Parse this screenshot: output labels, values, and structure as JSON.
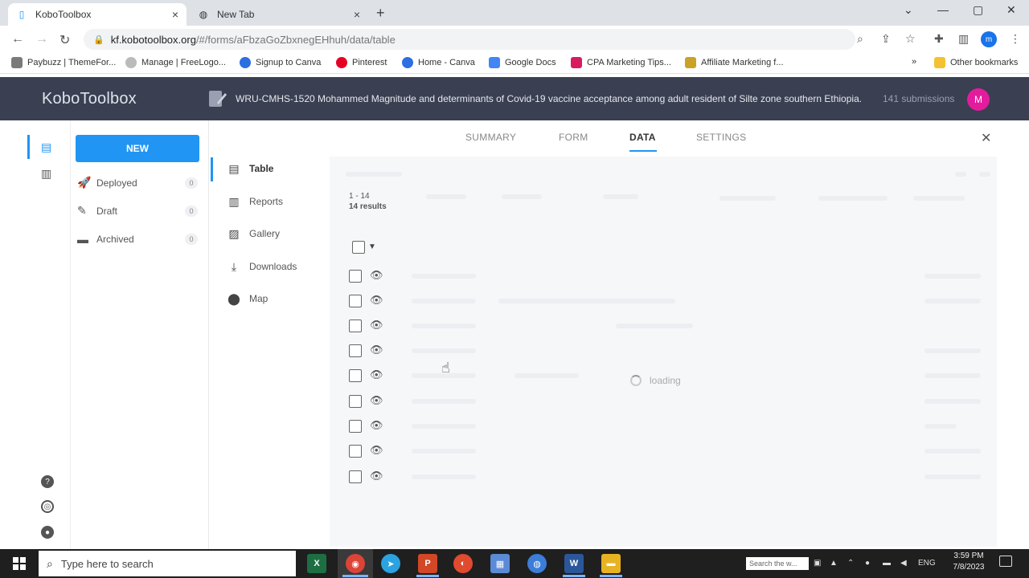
{
  "browser": {
    "tabs": [
      {
        "title": "KoboToolbox",
        "close": "×"
      },
      {
        "title": "New Tab",
        "close": "×"
      }
    ],
    "new_tab": "+",
    "window_controls": {
      "chevron": "⌄",
      "minimize": "—",
      "maximize": "▢",
      "close": "✕"
    },
    "url_host": "kf.kobotoolbox.org",
    "url_path": "/#/forms/aFbzaGoZbxnegEHhuh/data/table",
    "profile_initial": "m",
    "bookmarks": [
      {
        "label": "Paybuzz | ThemeFor...",
        "color": "#7a7a7a"
      },
      {
        "label": "Manage | FreeLogo...",
        "color": "#bbbbbb"
      },
      {
        "label": "Signup to Canva",
        "color": "#2d6ee0"
      },
      {
        "label": "Pinterest",
        "color": "#e60023"
      },
      {
        "label": "Home - Canva",
        "color": "#2d6ee0"
      },
      {
        "label": "Google Docs",
        "color": "#4285f4"
      },
      {
        "label": "CPA Marketing Tips...",
        "color": "#d81b60"
      },
      {
        "label": "Affiliate Marketing f...",
        "color": "#c9a227"
      }
    ],
    "other_bookmarks": "Other bookmarks",
    "more_bookmarks": "»"
  },
  "kobo": {
    "logo": "KoboToolbox",
    "project_title": "WRU-CMHS-1520 Mohammed Magnitude and determinants of Covid-19 vaccine acceptance among adult resident of Silte zone southern Ethiopia...",
    "submissions": "141 submissions",
    "avatar_initial": "M"
  },
  "sidebar": {
    "new_label": "NEW",
    "items": [
      {
        "label": "Deployed",
        "count": "0"
      },
      {
        "label": "Draft",
        "count": "0"
      },
      {
        "label": "Archived",
        "count": "0"
      }
    ]
  },
  "top_tabs": {
    "summary": "SUMMARY",
    "form": "FORM",
    "data": "DATA",
    "settings": "SETTINGS",
    "close": "✕"
  },
  "data_nav": {
    "items": [
      {
        "label": "Table"
      },
      {
        "label": "Reports"
      },
      {
        "label": "Gallery"
      },
      {
        "label": "Downloads"
      },
      {
        "label": "Map"
      }
    ]
  },
  "table": {
    "range": "1 - 14",
    "results": "14 results",
    "loading": "loading"
  },
  "taskbar": {
    "search_placeholder": "Type here to search",
    "lang": "ENG",
    "time": "3:59 PM",
    "date": "7/8/2023",
    "weather_box": "Search the w...",
    "apps": [
      {
        "label": "X",
        "color": "#1d6f42"
      },
      {
        "label": "◉",
        "color": "#db4437"
      },
      {
        "label": "➤",
        "color": "#2aa3e0"
      },
      {
        "label": "P",
        "color": "#d24726"
      },
      {
        "label": "◐",
        "color": "#e04a2f"
      },
      {
        "label": "▦",
        "color": "#5b8bd6"
      },
      {
        "label": "◍",
        "color": "#3b7dd8"
      },
      {
        "label": "W",
        "color": "#2b579a"
      },
      {
        "label": "▬",
        "color": "#e8b322"
      }
    ]
  }
}
